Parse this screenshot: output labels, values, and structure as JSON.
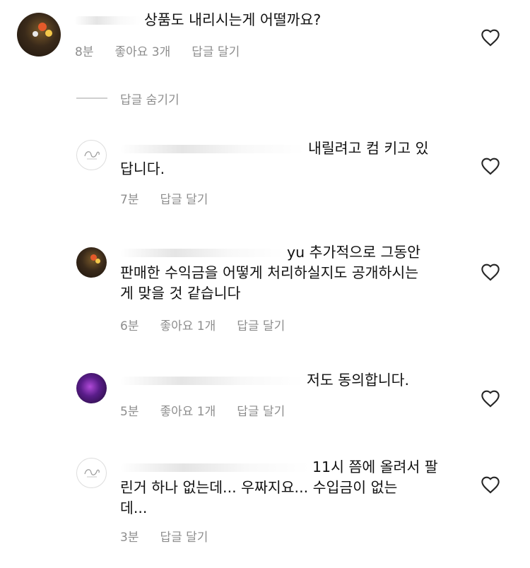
{
  "comments": [
    {
      "text_lines": [
        "상품도 내리시는게 어떨까요?"
      ],
      "time": "8분",
      "likes": "좋아요 3개",
      "reply": "답글 달기"
    },
    {
      "text_lines": [
        "내릴려고 컴 키고 있",
        "답니다."
      ],
      "time": "7분",
      "likes": "",
      "reply": "답글 달기"
    },
    {
      "text_lines": [
        "yu 추가적으로 그동안",
        "판매한 수익금을 어떻게 처리하실지도 공개하시는",
        "게 맞을 것 같습니다"
      ],
      "time": "6분",
      "likes": "좋아요 1개",
      "reply": "답글 달기"
    },
    {
      "text_lines": [
        "저도 동의합니다."
      ],
      "time": "5분",
      "likes": "좋아요 1개",
      "reply": "답글 달기"
    },
    {
      "text_lines": [
        "11시 쯤에 올려서 팔",
        "린거 하나 없는데... 우짜지요... 수입금이 없는",
        "데..."
      ],
      "time": "3분",
      "likes": "",
      "reply": "답글 달기"
    }
  ],
  "replies_toggle": {
    "label": "답글 숨기기"
  },
  "icons": {
    "like": "heart-outline-icon",
    "avatar_logo": "logo-avatar-icon"
  },
  "colors": {
    "meta": "#8e8e8e",
    "text": "#111111"
  }
}
